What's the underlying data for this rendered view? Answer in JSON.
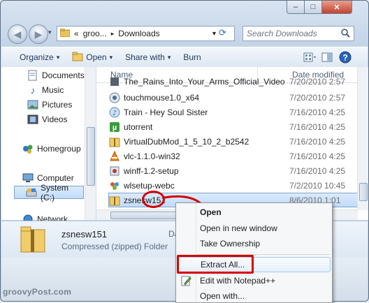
{
  "window": {
    "minimize_glyph": "–",
    "maximize_glyph": "□",
    "close_glyph": "✕"
  },
  "address": {
    "overflow": "«",
    "parent": "groo...",
    "separator": "▸",
    "current": "Downloads",
    "dropdown": "▾",
    "refresh_glyph": "⟳"
  },
  "search": {
    "placeholder": "Search Downloads",
    "icon": "search-icon"
  },
  "toolbar": {
    "organize": "Organize",
    "open": "Open",
    "share": "Share with",
    "burn": "Burn",
    "arrow": "▾"
  },
  "sidebar": {
    "items": [
      {
        "label": "Documents",
        "icon": "documents-icon"
      },
      {
        "label": "Music",
        "icon": "music-icon"
      },
      {
        "label": "Pictures",
        "icon": "pictures-icon"
      },
      {
        "label": "Videos",
        "icon": "videos-icon"
      },
      {
        "label": "Homegroup",
        "icon": "homegroup-icon"
      },
      {
        "label": "Computer",
        "icon": "computer-icon"
      },
      {
        "label": "System (C:)",
        "icon": "drive-icon"
      },
      {
        "label": "Network",
        "icon": "network-icon"
      }
    ]
  },
  "filelist": {
    "col_name": "Name",
    "col_date": "Date modified",
    "rows": [
      {
        "name": "The_Rains_Into_Your_Arms_Official_Video",
        "date": "7/20/2010 2:57",
        "icon": "video-file-icon"
      },
      {
        "name": "touchmouse1.0_x64",
        "date": "7/20/2010 2:57",
        "icon": "setup-icon"
      },
      {
        "name": "Train - Hey Soul Sister",
        "date": "7/16/2010 4:25",
        "icon": "itunes-file-icon"
      },
      {
        "name": "utorrent",
        "date": "7/16/2010 4:25",
        "icon": "utorrent-icon"
      },
      {
        "name": "VirtualDubMod_1_5_10_2_b2542",
        "date": "7/16/2010 4:25",
        "icon": "zip-folder-icon"
      },
      {
        "name": "vlc-1.1.0-win32",
        "date": "7/16/2010 4:25",
        "icon": "vlc-icon"
      },
      {
        "name": "winff-1.2-setup",
        "date": "7/16/2010 4:25",
        "icon": "setup-icon"
      },
      {
        "name": "wlsetup-webc",
        "date": "7/2/2010 10:45",
        "icon": "live-setup-icon"
      },
      {
        "name": "zsnesw151",
        "date": "8/6/2010 1:01",
        "icon": "zip-folder-icon"
      }
    ]
  },
  "details": {
    "name": "zsnesw151",
    "type": "Compressed (zipped) Folder",
    "da_label": "Da"
  },
  "context_menu": {
    "items": [
      {
        "label": "Open",
        "bold": true
      },
      {
        "label": "Open in new window"
      },
      {
        "label": "Take Ownership"
      },
      {
        "label": "Extract All..."
      },
      {
        "label": "Edit with Notepad++"
      },
      {
        "label": "Open with..."
      }
    ]
  },
  "watermark": "groovyPost.com",
  "colors": {
    "highlight": "#d40000",
    "accent": "#1e395b"
  }
}
